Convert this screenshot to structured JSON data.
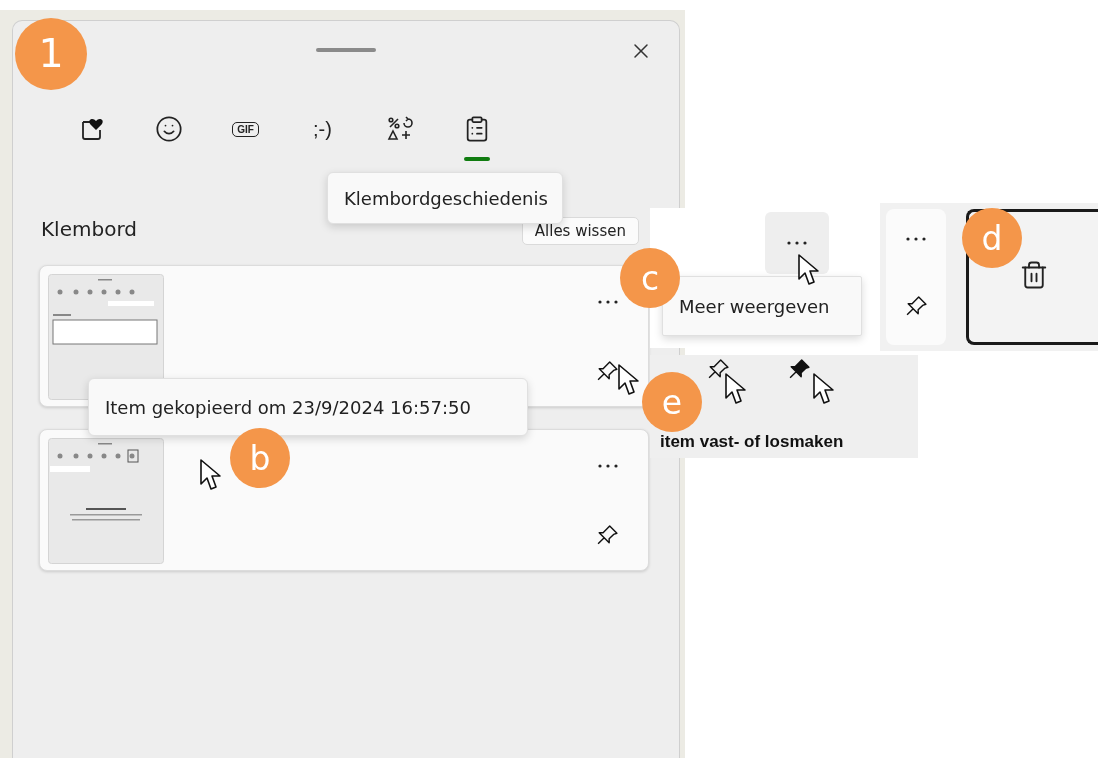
{
  "panel": {
    "badge": "1",
    "tabs": [
      {
        "kind": "favorites",
        "selected": false
      },
      {
        "kind": "emoji",
        "selected": false
      },
      {
        "kind": "gif",
        "label": "GIF",
        "selected": false
      },
      {
        "kind": "kaomoji",
        "label": ";-)",
        "selected": false
      },
      {
        "kind": "symbols",
        "selected": false
      },
      {
        "kind": "clipboard",
        "selected": true
      }
    ],
    "tab_tooltip": "Klembordgeschiedenis",
    "heading": "Klembord",
    "clear_button": "Alles wissen",
    "cards": [
      {
        "pinned": false
      },
      {
        "pinned": false
      }
    ]
  },
  "callout_b": {
    "badge": "b",
    "tooltip": "Item gekopieerd om 23/9/2024 16:57:50"
  },
  "callout_c": {
    "badge": "c",
    "tooltip": "Meer weergeven"
  },
  "callout_d": {
    "badge": "d"
  },
  "callout_e": {
    "badge": "e",
    "pins": [
      {
        "pinned": false
      },
      {
        "pinned": true
      }
    ],
    "caption": "item vast- of losmaken"
  }
}
